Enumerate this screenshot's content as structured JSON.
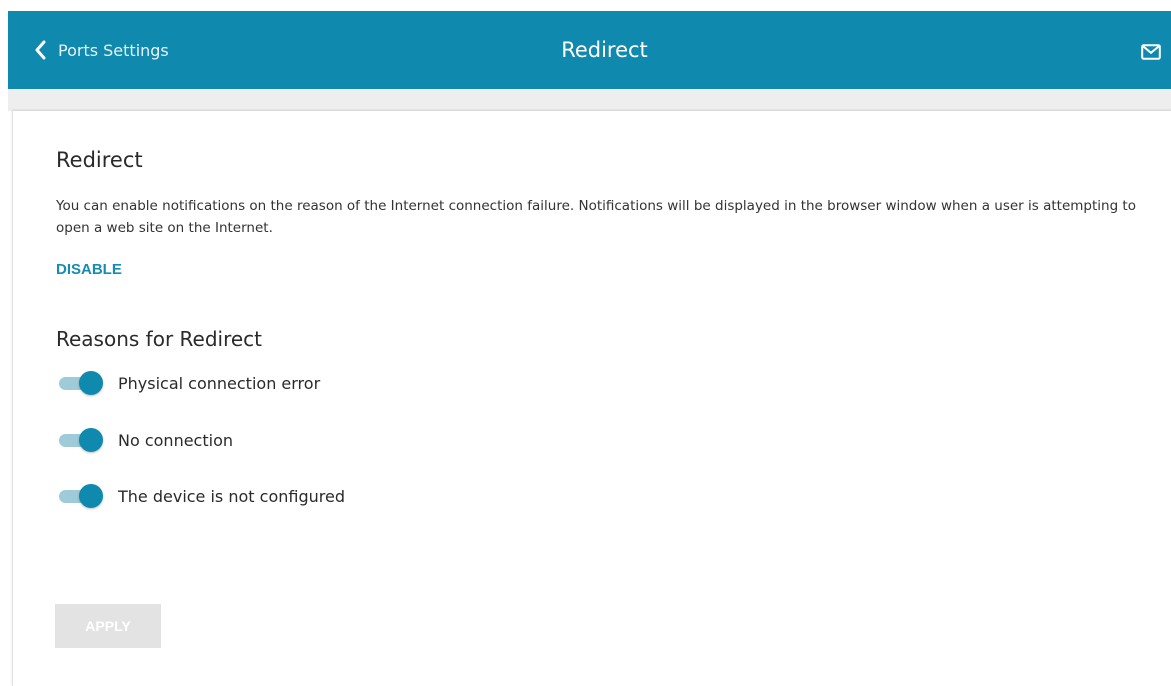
{
  "header": {
    "back_label": "Ports Settings",
    "title": "Redirect",
    "back_icon": "chevron-left-icon",
    "mail_icon": "envelope-icon",
    "background_color": "#0f89ad"
  },
  "main": {
    "section_title": "Redirect",
    "description": "You can enable notifications on the reason of the Internet connection failure. Notifications will be displayed in the browser window when a user is attempting to open a web site on the Internet.",
    "disable_label": "DISABLE",
    "reasons_title": "Reasons for Redirect",
    "reasons": [
      {
        "label": "Physical connection error",
        "enabled": true
      },
      {
        "label": "No connection",
        "enabled": true
      },
      {
        "label": "The device is not configured",
        "enabled": true
      }
    ],
    "apply_label": "APPLY",
    "apply_disabled": true,
    "accent_color": "#168cb4"
  }
}
